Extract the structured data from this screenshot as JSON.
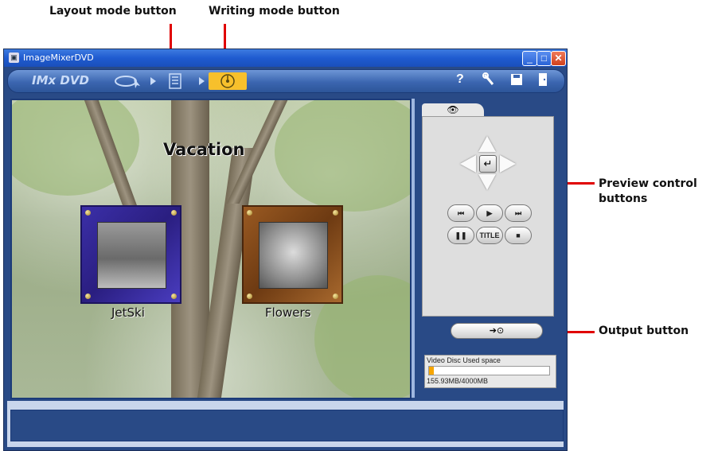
{
  "callouts": {
    "layout_mode": "Layout mode button",
    "writing_mode": "Writing mode button",
    "preview_controls_line1": "Preview control",
    "preview_controls_line2": "buttons",
    "output": "Output button"
  },
  "window": {
    "title": "ImageMixerDVD",
    "logo": "IMx DVD"
  },
  "toolbar": {
    "right_icons": [
      "help-icon",
      "wrench-icon",
      "save-icon",
      "door-exit-icon"
    ]
  },
  "menu": {
    "title": "Vacation",
    "items": [
      {
        "label": "JetSki"
      },
      {
        "label": "Flowers"
      }
    ]
  },
  "preview": {
    "tab_icon": "eye-icon",
    "buttons": [
      "previous-chapter",
      "play",
      "next-chapter",
      "pause",
      "TITLE",
      "stop"
    ],
    "title_label": "TITLE"
  },
  "disc": {
    "label": "Video Disc  Used space",
    "used_text": "155.93MB/4000MB",
    "used_fraction": 0.039
  },
  "colors": {
    "window_bg": "#294a86",
    "highlight": "#f7c02c",
    "callout_line": "#e00000"
  }
}
